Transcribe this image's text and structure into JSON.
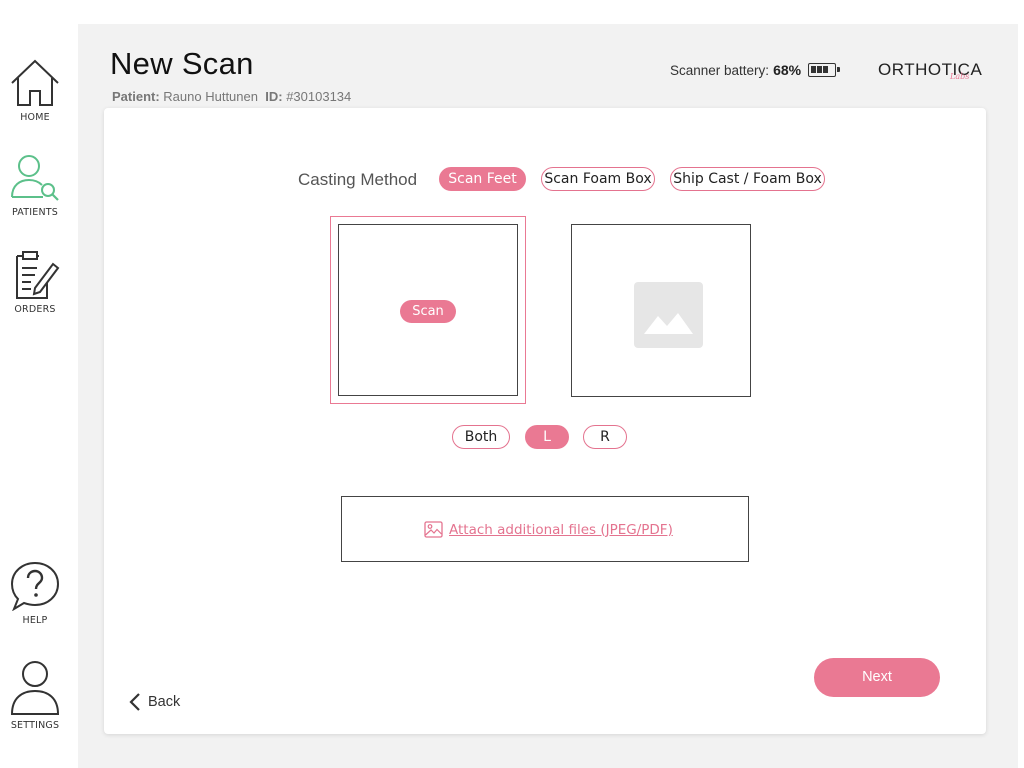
{
  "nav": {
    "home": "HOME",
    "patients": "PATIENTS",
    "orders": "ORDERS",
    "help": "HELP",
    "settings": "SETTINGS"
  },
  "header": {
    "title": "New Scan",
    "patient_label": "Patient:",
    "patient_name": "Rauno Huttunen",
    "id_label": "ID:",
    "patient_id": "#30103134",
    "battery_label": "Scanner battery:",
    "battery_percent": "68%",
    "battery_level": 0.68,
    "brand_name": "ORTHOTICA",
    "brand_sub": "Labs"
  },
  "casting": {
    "label": "Casting Method",
    "options": [
      "Scan Feet",
      "Scan Foam Box",
      "Ship Cast / Foam Box"
    ],
    "selected": "Scan Feet"
  },
  "scan": {
    "button_label": "Scan"
  },
  "side": {
    "options": [
      "Both",
      "L",
      "R"
    ],
    "selected": "L"
  },
  "attach": {
    "label": "Attach additional files (JPEG/PDF)"
  },
  "footer": {
    "back_label": "Back",
    "next_label": "Next"
  },
  "colors": {
    "accent": "#ea7993",
    "patients_icon": "#5cc08a",
    "background": "#f2f2f2"
  },
  "icons": {
    "home": "home-icon",
    "patients": "user-search-icon",
    "orders": "document-edit-icon",
    "help": "help-bubble-icon",
    "settings": "user-icon",
    "attach": "image-icon",
    "back": "chevron-left-icon",
    "placeholder": "image-placeholder-icon"
  }
}
